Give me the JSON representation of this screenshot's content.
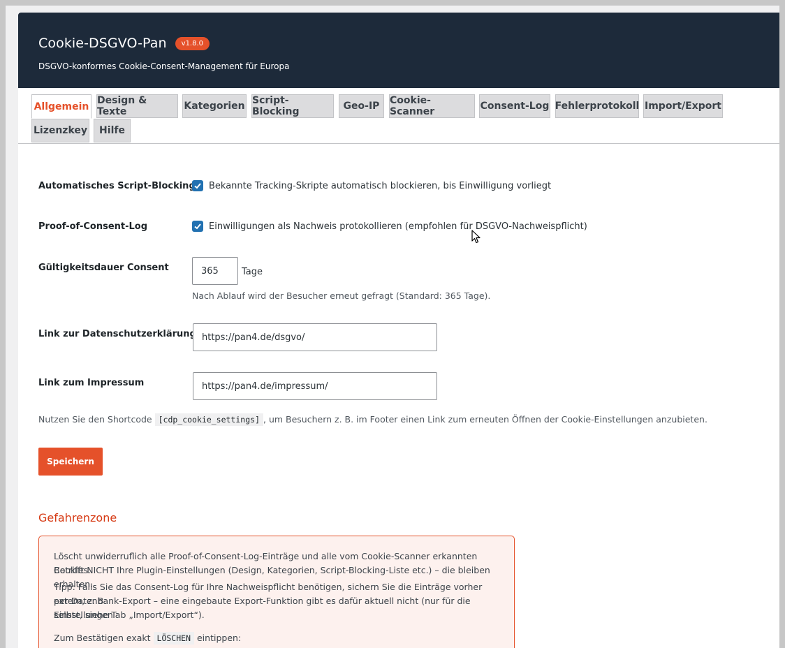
{
  "header": {
    "title": "Cookie-DSGVO-Pan",
    "version": "v1.8.0",
    "subtitle": "DSGVO-konformes Cookie-Consent-Management für Europa"
  },
  "tabs": [
    {
      "label": "Allgemein",
      "active": true
    },
    {
      "label": "Design & Texte"
    },
    {
      "label": "Kategorien"
    },
    {
      "label": "Script-Blocking"
    },
    {
      "label": "Geo-IP"
    },
    {
      "label": "Cookie-Scanner"
    },
    {
      "label": "Consent-Log"
    },
    {
      "label": "Fehlerprotokoll"
    },
    {
      "label": "Import/Export"
    },
    {
      "label": "Lizenzkey"
    },
    {
      "label": "Hilfe"
    }
  ],
  "settings": {
    "script_blocking": {
      "label": "Automatisches Script-Blocking",
      "checkbox_text": "Bekannte Tracking-Skripte automatisch blockieren, bis Einwilligung vorliegt",
      "checked": true
    },
    "consent_log": {
      "label": "Proof-of-Consent-Log",
      "checkbox_text": "Einwilligungen als Nachweis protokollieren (empfohlen für DSGVO-Nachweispflicht)",
      "checked": true
    },
    "validity": {
      "label": "Gültigkeitsdauer Consent",
      "value": "365",
      "unit": "Tage",
      "description": "Nach Ablauf wird der Besucher erneut gefragt (Standard: 365 Tage)."
    },
    "privacy_link": {
      "label": "Link zur Datenschutzerklärung",
      "value": "https://pan4.de/dsgvo/"
    },
    "imprint_link": {
      "label": "Link zum Impressum",
      "value": "https://pan4.de/impressum/"
    },
    "shortcode_note": {
      "before": "Nutzen Sie den Shortcode",
      "code": "[cdp_cookie_settings]",
      "after": ", um Besuchern z. B. im Footer einen Link zum erneuten Öffnen der Cookie-Einstellungen anzubieten."
    },
    "save_label": "Speichern"
  },
  "danger_zone": {
    "title": "Gefahrenzone",
    "p1_line1": "Löscht unwiderruflich alle Proof-of-Consent-Log-Einträge und alle vom Cookie-Scanner erkannten Cookies.",
    "p1_line2": "Betrifft NICHT Ihre Plugin-Einstellungen (Design, Kategorien, Script-Blocking-Liste etc.) – die bleiben erhalten.",
    "p2_line1": "Tipp: Falls Sie das Consent-Log für Ihre Nachweispflicht benötigen, sichern Sie die Einträge vorher extern, z. B.",
    "p2_line2": "per Datenbank-Export – eine eingebaute Export-Funktion gibt es dafür aktuell nicht (nur für die Einstellungen",
    "p2_line3": "selbst, siehe Tab „Import/Export“).",
    "confirm_before": "Zum Bestätigen exakt",
    "confirm_code": "LÖSCHEN",
    "confirm_after": "eintippen:"
  },
  "colors": {
    "accent": "#e5512a",
    "header_bg": "#1d2a3a",
    "checkbox": "#2271b1",
    "danger_bg": "#fdf1ee"
  }
}
